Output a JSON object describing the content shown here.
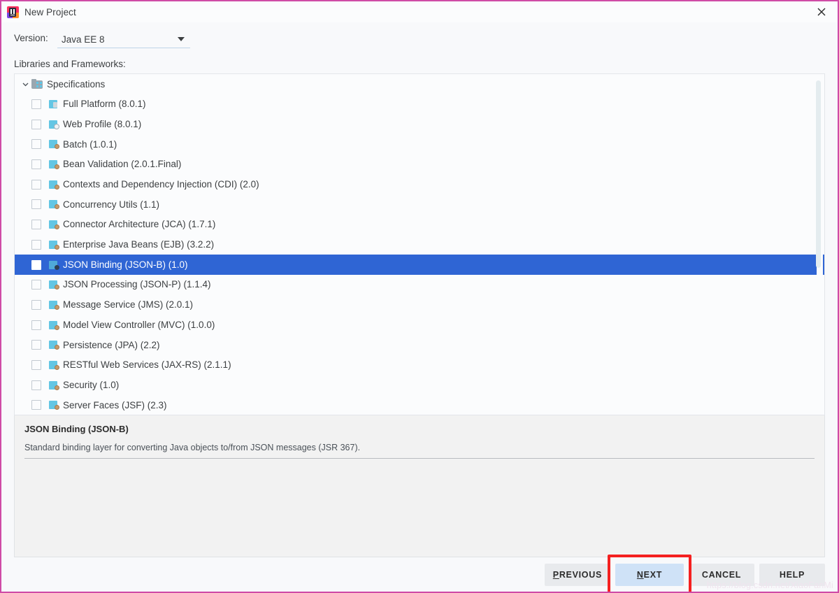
{
  "window": {
    "title": "New Project",
    "app_icon": "intellij-idea-icon",
    "close_icon": "close-icon",
    "border_color": "#cf4ba6"
  },
  "form": {
    "version_label": "Version:",
    "version_value": "Java EE 8",
    "libraries_label": "Libraries and Frameworks:"
  },
  "tree": {
    "root": {
      "label": "Specifications",
      "expanded": true,
      "icon": "folder-modules-icon"
    },
    "items": [
      {
        "label": "Full Platform (8.0.1)",
        "checked": false,
        "selected": false,
        "icon": "platform-icon"
      },
      {
        "label": "Web Profile (8.0.1)",
        "checked": false,
        "selected": false,
        "icon": "web-profile-icon"
      },
      {
        "label": "Batch (1.0.1)",
        "checked": false,
        "selected": false,
        "icon": "spec-icon"
      },
      {
        "label": "Bean Validation (2.0.1.Final)",
        "checked": false,
        "selected": false,
        "icon": "spec-icon"
      },
      {
        "label": "Contexts and Dependency Injection (CDI) (2.0)",
        "checked": false,
        "selected": false,
        "icon": "spec-icon"
      },
      {
        "label": "Concurrency Utils (1.1)",
        "checked": false,
        "selected": false,
        "icon": "spec-icon"
      },
      {
        "label": "Connector Architecture (JCA) (1.7.1)",
        "checked": false,
        "selected": false,
        "icon": "spec-icon"
      },
      {
        "label": "Enterprise Java Beans (EJB) (3.2.2)",
        "checked": false,
        "selected": false,
        "icon": "spec-icon"
      },
      {
        "label": "JSON Binding (JSON-B) (1.0)",
        "checked": false,
        "selected": true,
        "icon": "spec-icon"
      },
      {
        "label": "JSON Processing (JSON-P) (1.1.4)",
        "checked": false,
        "selected": false,
        "icon": "spec-icon"
      },
      {
        "label": "Message Service (JMS) (2.0.1)",
        "checked": false,
        "selected": false,
        "icon": "spec-icon"
      },
      {
        "label": "Model View Controller (MVC) (1.0.0)",
        "checked": false,
        "selected": false,
        "icon": "spec-icon"
      },
      {
        "label": "Persistence (JPA) (2.2)",
        "checked": false,
        "selected": false,
        "icon": "spec-icon"
      },
      {
        "label": "RESTful Web Services (JAX-RS) (2.1.1)",
        "checked": false,
        "selected": false,
        "icon": "spec-icon"
      },
      {
        "label": "Security (1.0)",
        "checked": false,
        "selected": false,
        "icon": "spec-icon"
      },
      {
        "label": "Server Faces (JSF) (2.3)",
        "checked": false,
        "selected": false,
        "icon": "spec-icon"
      }
    ],
    "selection_color": "#2f65d4"
  },
  "description": {
    "title": "JSON Binding (JSON-B)",
    "text": "Standard binding layer for converting Java objects to/from JSON messages (JSR 367)."
  },
  "buttons": {
    "previous": {
      "label": "PREVIOUS",
      "mnemonic": "P",
      "rest": "REVIOUS"
    },
    "next": {
      "label": "NEXT",
      "mnemonic": "N",
      "rest": "EXT",
      "highlighted": true,
      "highlight_color": "#f42020"
    },
    "cancel": {
      "label": "CANCEL"
    },
    "help": {
      "label": "HELP"
    }
  },
  "watermark": "https://blog.csdn.net/XiaoFanMi"
}
